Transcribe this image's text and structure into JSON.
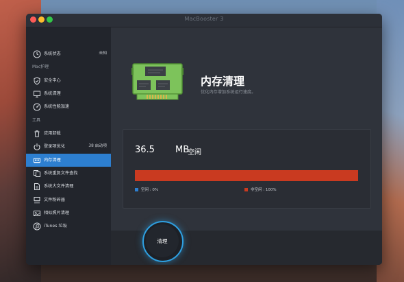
{
  "window": {
    "title": "MacBooster 3"
  },
  "sidebar": {
    "items": [
      {
        "label": "系统状态",
        "badge": "未知",
        "icon": "clock-icon"
      },
      {
        "label": "安全中心",
        "icon": "shield-icon"
      },
      {
        "label": "系统清理",
        "icon": "monitor-icon"
      },
      {
        "label": "系统性能加速",
        "icon": "speed-icon"
      },
      {
        "label": "应用卸载",
        "icon": "trash-icon"
      },
      {
        "label": "登录项优化",
        "badge": "38 启动项",
        "icon": "power-icon"
      },
      {
        "label": "内存清理",
        "icon": "memory-icon"
      },
      {
        "label": "系统重复文件查找",
        "icon": "duplicate-icon"
      },
      {
        "label": "系统大文件清理",
        "icon": "files-icon"
      },
      {
        "label": "文件粉碎器",
        "icon": "shredder-icon"
      },
      {
        "label": "相似照片清理",
        "icon": "photo-icon"
      },
      {
        "label": "iTunes 垃圾",
        "icon": "music-icon"
      }
    ],
    "sections": [
      "Mac护理",
      "工具"
    ]
  },
  "main": {
    "title": "内存清理",
    "subtitle": "优化内存增加系统运行速度。",
    "memory": {
      "value": "36.5",
      "unit": "MB",
      "free_label": "空闲",
      "free_percent": 0,
      "used_percent": 100
    },
    "legend": {
      "free": "空闲 : 0%",
      "used": "非空闲 : 100%"
    },
    "action_button": "清理"
  },
  "colors": {
    "accent": "#2d7fd0",
    "used": "#c93a20",
    "free": "#3c7fd4",
    "button_glow": "#2e9fe0",
    "chip_green": "#7dc35b"
  }
}
